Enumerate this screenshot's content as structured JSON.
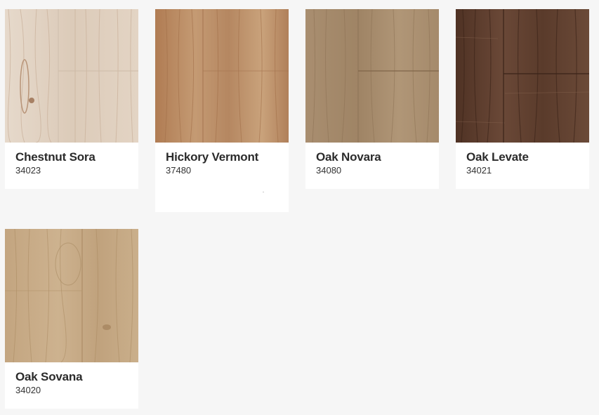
{
  "products": [
    {
      "name": "Chestnut Sora",
      "code": "34023",
      "swatch": "chestnut-sora"
    },
    {
      "name": "Hickory Vermont",
      "code": "37480",
      "swatch": "hickory-vermont"
    },
    {
      "name": "Oak Novara",
      "code": "34080",
      "swatch": "oak-novara"
    },
    {
      "name": "Oak Levate",
      "code": "34021",
      "swatch": "oak-levate"
    },
    {
      "name": "Oak Sovana",
      "code": "34020",
      "swatch": "oak-sovana"
    }
  ],
  "colors": {
    "page_background": "#f6f6f6",
    "card_background": "#ffffff",
    "title_text": "#2b2b2b",
    "code_text": "#333333",
    "chestnut_sora": "#dfd0c0",
    "hickory_vermont": "#b98a62",
    "oak_novara": "#a88d6e",
    "oak_levate": "#5e3f2e",
    "oak_sovana": "#c6aa86"
  }
}
